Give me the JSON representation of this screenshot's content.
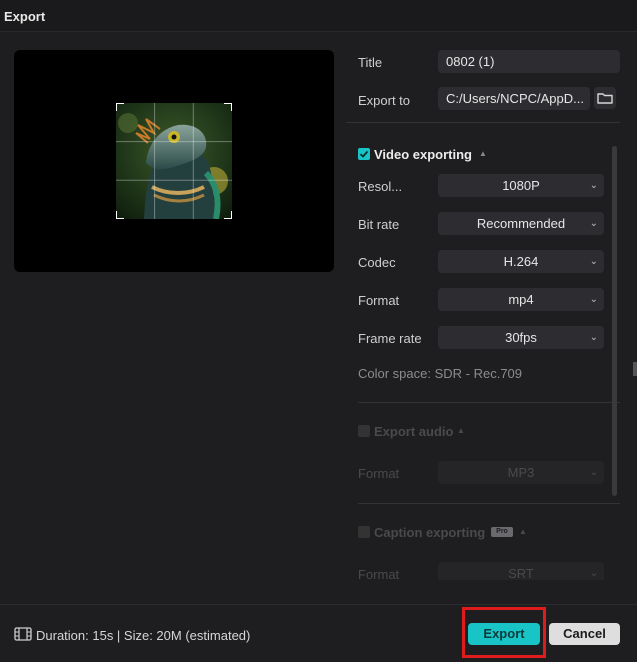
{
  "window": {
    "title": "Export"
  },
  "form": {
    "title_label": "Title",
    "title_value": "0802 (1)",
    "export_to_label": "Export to",
    "export_to_value": "C:/Users/NCPC/AppD..."
  },
  "video": {
    "section_label": "Video exporting",
    "checked": true,
    "resolution_label": "Resol...",
    "resolution_value": "1080P",
    "bitrate_label": "Bit rate",
    "bitrate_value": "Recommended",
    "codec_label": "Codec",
    "codec_value": "H.264",
    "format_label": "Format",
    "format_value": "mp4",
    "framerate_label": "Frame rate",
    "framerate_value": "30fps",
    "color_space": "Color space: SDR - Rec.709"
  },
  "audio": {
    "section_label": "Export audio",
    "checked": false,
    "format_label": "Format",
    "format_value": "MP3"
  },
  "caption": {
    "section_label": "Caption exporting",
    "pro_badge": "Pro",
    "checked": false,
    "format_label": "Format",
    "format_value": "SRT"
  },
  "footer": {
    "summary": "Duration: 15s | Size: 20M (estimated)",
    "export_label": "Export",
    "cancel_label": "Cancel"
  },
  "colors": {
    "accent": "#19c4c7",
    "highlight": "#e01b1b",
    "background": "#1e1e20"
  },
  "icons": [
    "folder-icon",
    "film-icon",
    "chevron-down-icon",
    "checkbox-icon"
  ]
}
